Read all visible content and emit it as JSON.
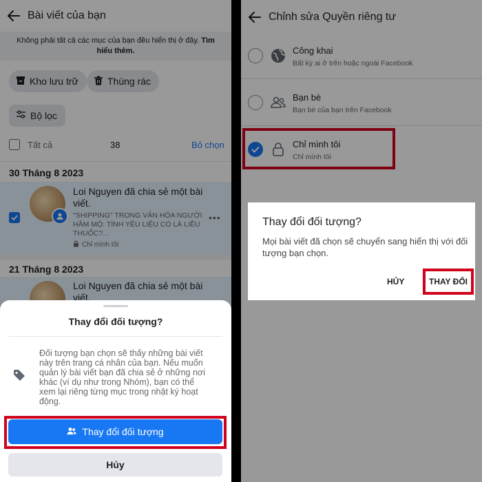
{
  "left": {
    "header_title": "Bài viết của bạn",
    "info_text": "Không phải tất cả các mục của bạn đều hiển thị ở đây. ",
    "info_link": "Tìm hiểu thêm.",
    "archive_label": "Kho lưu trữ",
    "trash_label": "Thùng rác",
    "filter_label": "Bộ lọc",
    "select_all_label": "Tất cả",
    "count": "38",
    "deselect_label": "Bỏ chọn",
    "sections": [
      {
        "date": "30 Tháng 8 2023",
        "post": {
          "title": "Loi Nguyen đã chia sẻ một bài viết.",
          "subtitle": "\"SHIPPING\" TRONG VĂN HÓA NGƯỜI HÂM MỘ: TÌNH YÊU LIỆU CÓ LÀ LIỀU THUỐC?...",
          "privacy": "Chỉ mình tôi"
        }
      },
      {
        "date": "21 Tháng 8 2023",
        "post": {
          "title": "Loi Nguyen đã chia sẻ một bài viết."
        }
      }
    ],
    "sheet": {
      "title": "Thay đổi đối tượng?",
      "description": "Đối tượng bạn chọn sẽ thấy những bài viết này trên trang cá nhân của bạn. Nếu muốn quản lý bài viết bạn đã chia sẻ ở những nơi khác (ví dụ như trong Nhóm), bạn có thể xem lại riêng từng mục trong nhật ký hoạt động.",
      "primary_label": "Thay đổi đối tượng",
      "cancel_label": "Hủy"
    }
  },
  "right": {
    "header_title": "Chỉnh sửa Quyền riêng tư",
    "options": [
      {
        "name": "Công khai",
        "desc": "Bất kỳ ai ở trên hoặc ngoài Facebook",
        "icon": "globe-icon",
        "selected": false
      },
      {
        "name": "Bạn bè",
        "desc": "Bạn bè của bạn trên Facebook",
        "icon": "friends-icon",
        "selected": false
      },
      {
        "name": "Chỉ mình tôi",
        "desc": "Chỉ mình tôi",
        "icon": "lock-icon",
        "selected": true
      }
    ],
    "dialog": {
      "title": "Thay đổi đối tượng?",
      "message": "Mọi bài viết đã chọn sẽ chuyển sang hiển thị với đối tượng bạn chọn.",
      "cancel_label": "HỦY",
      "confirm_label": "THAY ĐỔI"
    }
  },
  "colors": {
    "accent": "#1877f2",
    "highlight_box": "#d0021b",
    "selected_row_bg": "#e7f3ff"
  }
}
